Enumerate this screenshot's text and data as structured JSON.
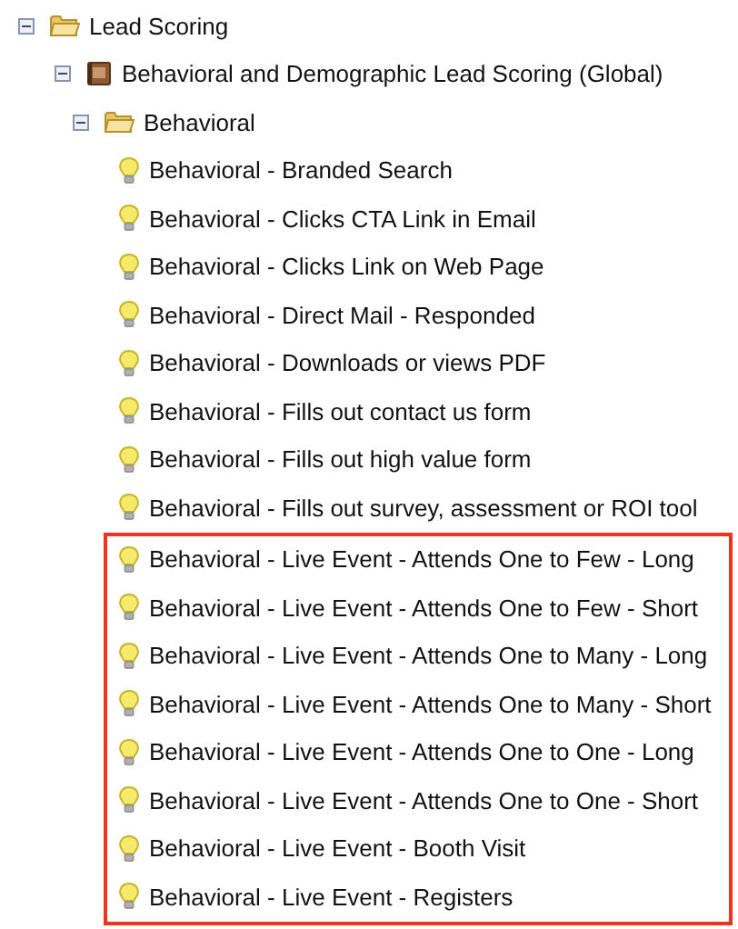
{
  "tree": [
    {
      "label": "Lead Scoring",
      "kind": "folder",
      "expanded": true,
      "children": [
        {
          "label": "Behavioral and Demographic Lead Scoring (Global)",
          "kind": "program",
          "expanded": true,
          "children": [
            {
              "label": "Behavioral",
              "kind": "folder",
              "expanded": true,
              "children": [
                {
                  "label": "Behavioral - Branded Search",
                  "kind": "campaign",
                  "highlighted": false
                },
                {
                  "label": "Behavioral - Clicks CTA Link in Email",
                  "kind": "campaign",
                  "highlighted": false
                },
                {
                  "label": "Behavioral - Clicks Link on Web Page",
                  "kind": "campaign",
                  "highlighted": false
                },
                {
                  "label": "Behavioral - Direct Mail - Responded",
                  "kind": "campaign",
                  "highlighted": false
                },
                {
                  "label": "Behavioral - Downloads or views PDF",
                  "kind": "campaign",
                  "highlighted": false
                },
                {
                  "label": "Behavioral - Fills out contact us form",
                  "kind": "campaign",
                  "highlighted": false
                },
                {
                  "label": "Behavioral - Fills out high value form",
                  "kind": "campaign",
                  "highlighted": false
                },
                {
                  "label": "Behavioral - Fills out survey, assessment or ROI tool",
                  "kind": "campaign",
                  "highlighted": false
                },
                {
                  "label": "Behavioral - Live Event - Attends One to Few - Long",
                  "kind": "campaign",
                  "highlighted": true
                },
                {
                  "label": "Behavioral - Live Event - Attends One to Few - Short",
                  "kind": "campaign",
                  "highlighted": true
                },
                {
                  "label": "Behavioral - Live Event - Attends One to Many - Long",
                  "kind": "campaign",
                  "highlighted": true
                },
                {
                  "label": "Behavioral - Live Event - Attends One to Many - Short",
                  "kind": "campaign",
                  "highlighted": true
                },
                {
                  "label": "Behavioral - Live Event - Attends One to One - Long",
                  "kind": "campaign",
                  "highlighted": true
                },
                {
                  "label": "Behavioral - Live Event - Attends One to One - Short",
                  "kind": "campaign",
                  "highlighted": true
                },
                {
                  "label": "Behavioral - Live Event - Booth Visit",
                  "kind": "campaign",
                  "highlighted": true
                },
                {
                  "label": "Behavioral - Live Event - Registers",
                  "kind": "campaign",
                  "highlighted": true
                }
              ]
            }
          ]
        }
      ]
    }
  ]
}
